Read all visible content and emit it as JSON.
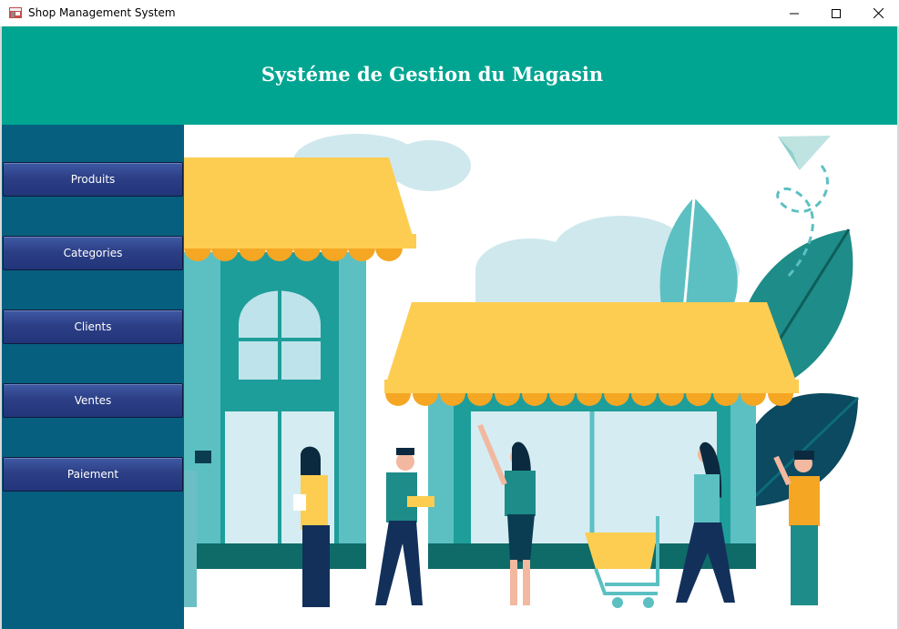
{
  "window": {
    "title": "Shop Management System",
    "icon": "shop-icon",
    "controls": [
      "minimize-icon",
      "maximize-icon",
      "close-icon"
    ]
  },
  "header": {
    "title": "Systéme de Gestion du Magasin",
    "background": "#00A591"
  },
  "sidebar": {
    "background": "#075F7F",
    "items": [
      {
        "label": "Produits"
      },
      {
        "label": "Categories"
      },
      {
        "label": "Clients"
      },
      {
        "label": "Ventes"
      },
      {
        "label": "Paiement"
      }
    ]
  },
  "illustration": {
    "description_icon": "shop-storefront-illustration",
    "colors": {
      "awning": "#FDCD52",
      "teal": "#1E9E9A",
      "light_teal": "#5CC0C2",
      "dark_teal": "#0B4A60"
    }
  }
}
